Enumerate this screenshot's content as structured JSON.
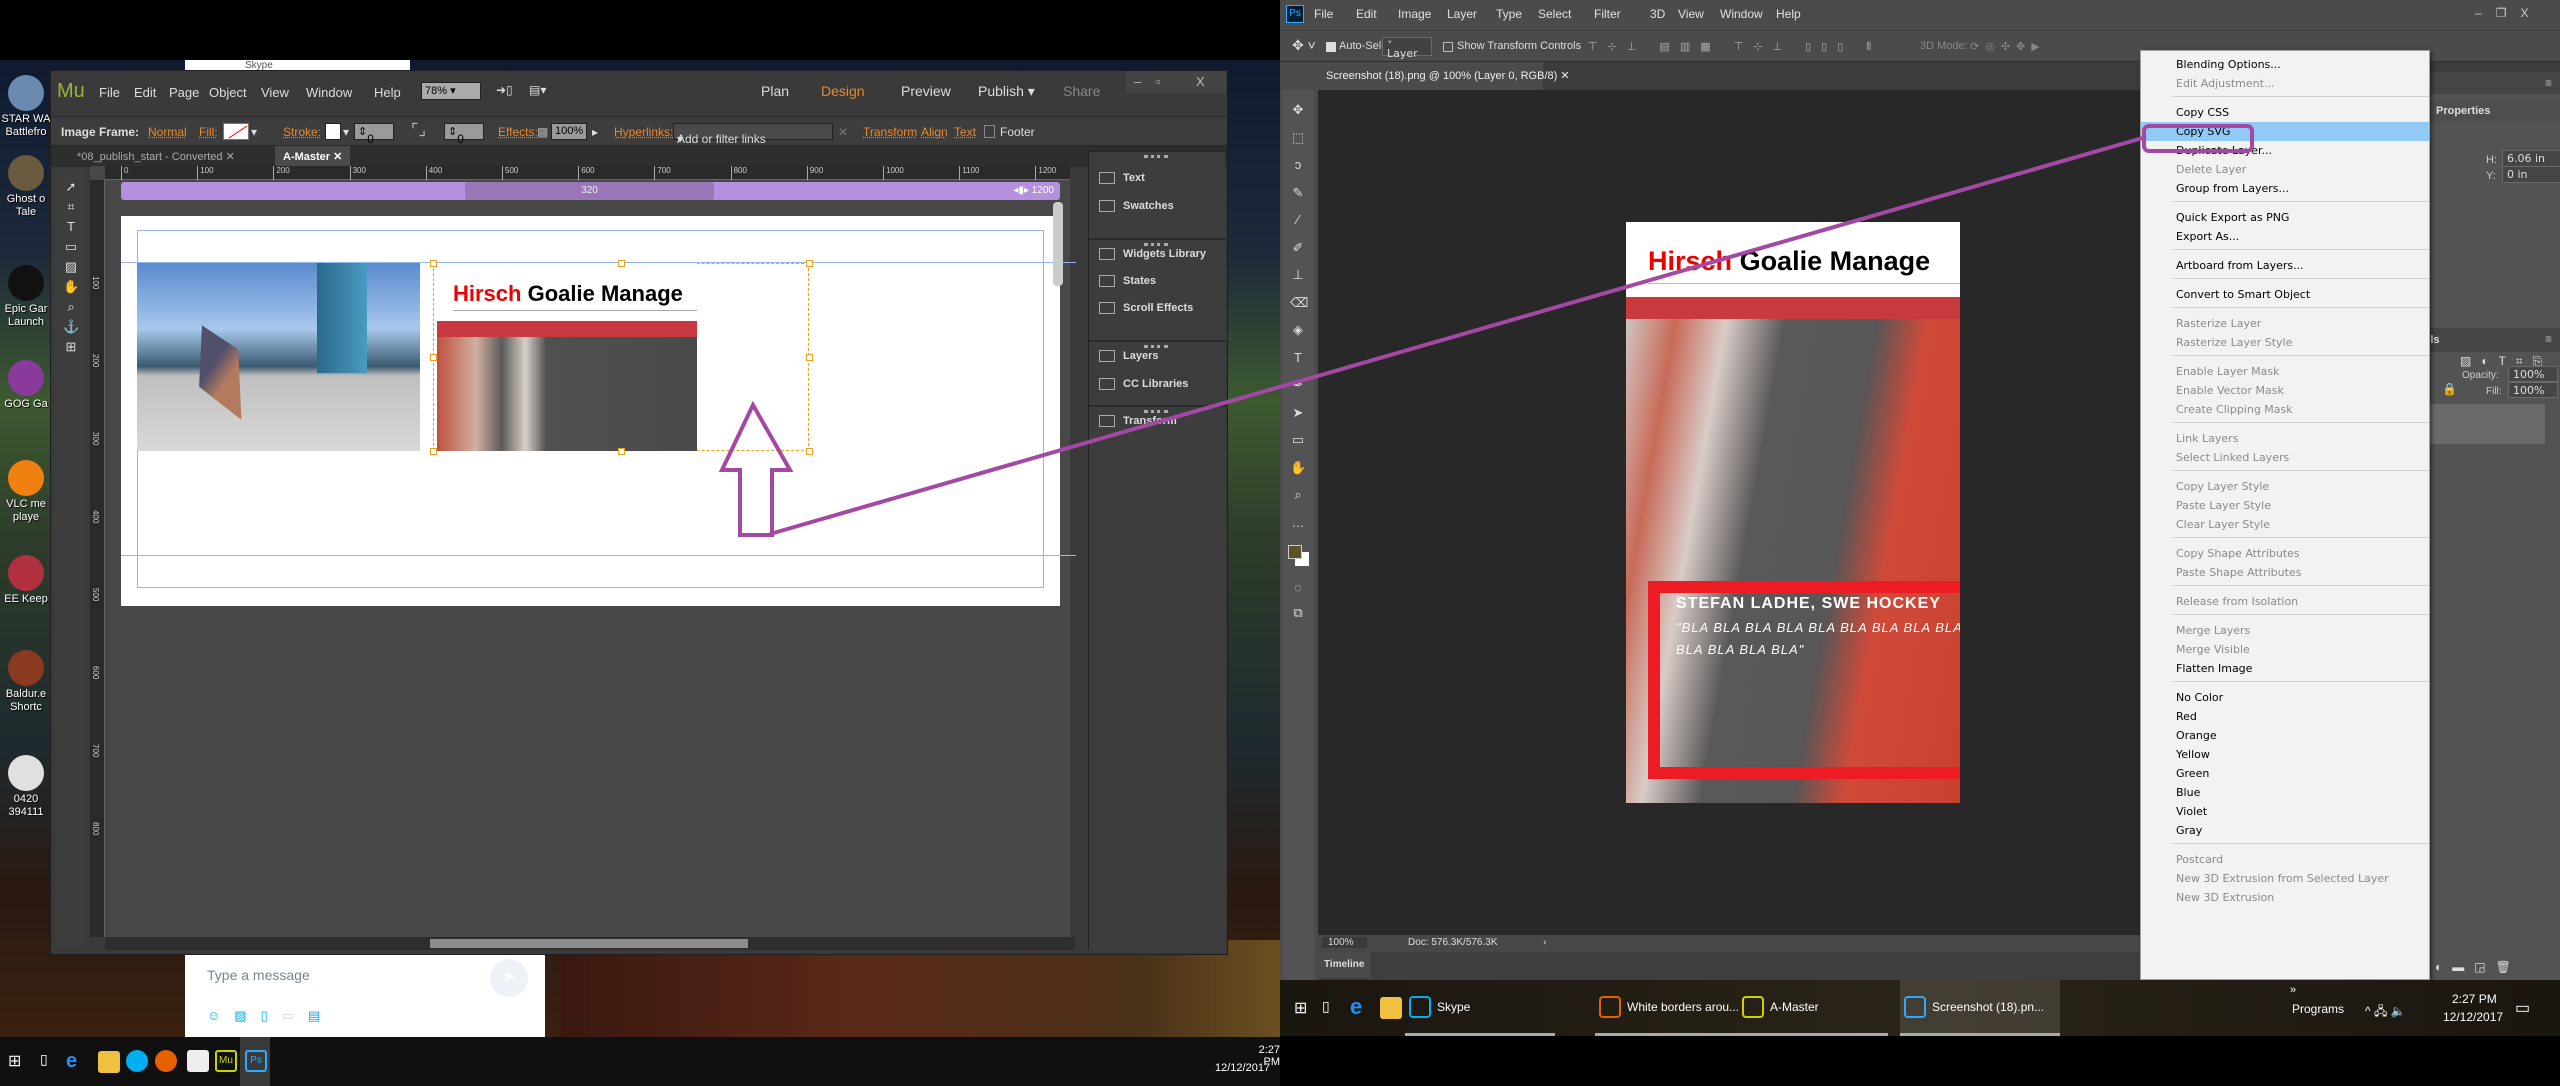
{
  "desktop": {
    "icons": [
      {
        "label": "STAR WA Battlefro",
        "color": "#6a8ab0"
      },
      {
        "label": "Ghost o Tale",
        "color": "#6a5a40"
      },
      {
        "label": "Epic Gar Launch",
        "color": "#111111"
      },
      {
        "label": "GOG Ga",
        "color": "#8a3a9a"
      },
      {
        "label": "VLC me playe",
        "color": "#f08010"
      },
      {
        "label": "EE Keep",
        "color": "#b03040"
      },
      {
        "label": "Baldur.e Shortc",
        "color": "#8a3a20"
      },
      {
        "label": "0420 394111",
        "color": "#e0e0e0"
      }
    ]
  },
  "skype": {
    "title": "Skype",
    "message_placeholder": "Type a message",
    "toolbar_icons": [
      "emoji-icon",
      "image-icon",
      "file-icon",
      "video-message-icon",
      "contact-icon"
    ]
  },
  "muse": {
    "logo": "Mu",
    "menu": [
      "File",
      "Edit",
      "Page",
      "Object",
      "View",
      "Window",
      "Help"
    ],
    "zoom": "78%",
    "modes": {
      "plan": "Plan",
      "design": "Design",
      "preview": "Preview",
      "publish": "Publish",
      "share": "Share"
    },
    "control_bar": {
      "image_frame_label": "Image Frame:",
      "image_frame_value": "Normal",
      "fill_label": "Fill:",
      "stroke_label": "Stroke:",
      "stroke_width": "0",
      "corner_radius": "0",
      "effects_label": "Effects:",
      "opacity": "100%",
      "hyperlinks_label": "Hyperlinks:",
      "hyperlinks_placeholder": "Add or filter links",
      "transform": "Transform",
      "align": "Align",
      "text": "Text",
      "footer": "Footer"
    },
    "tabs": [
      {
        "label": "*08_publish_start - Converted",
        "active": false
      },
      {
        "label": "A-Master",
        "active": true
      }
    ],
    "ruler_h": [
      "0",
      "100",
      "200",
      "300",
      "400",
      "500",
      "600",
      "700",
      "800",
      "900",
      "1000",
      "1100",
      "1200"
    ],
    "ruler_v": [
      "100",
      "200",
      "300",
      "400",
      "500",
      "600",
      "700",
      "800"
    ],
    "breakpoint_min": "320",
    "breakpoint_max": "1200",
    "page_heading_red": "Hirsch",
    "page_heading_black": "Goalie Manage",
    "panels": [
      "Text",
      "Swatches",
      "Widgets Library",
      "States",
      "Scroll Effects",
      "Layers",
      "CC Libraries",
      "Transform"
    ]
  },
  "photoshop": {
    "logo": "Ps",
    "menu": [
      "File",
      "Edit",
      "Image",
      "Layer",
      "Type",
      "Select",
      "Filter",
      "3D",
      "View",
      "Window",
      "Help"
    ],
    "options": {
      "auto_select_label": "Auto-Select:",
      "auto_select_checked": true,
      "auto_select_value": "Layer",
      "show_transform_label": "Show Transform Controls",
      "show_transform_checked": false,
      "mode_3d_label": "3D Mode:"
    },
    "doc_tab": "Screenshot (18).png @ 100% (Layer 0, RGB/8)",
    "document": {
      "heading_red": "Hirsch",
      "heading_black": "Goalie Manage",
      "caption": "STEFAN LADHE, SWE HOCKEY",
      "quote_line1": "\"BLA BLA BLA BLA BLA BLA BLA BLA BLA BL",
      "quote_line2": "BLA BLA BLA BLA\""
    },
    "status": {
      "zoom": "100%",
      "doc": "Doc: 576.3K/576.3K"
    },
    "timeline": "Timeline",
    "foreground_color": "#5f5226",
    "background_color": "#ffffff",
    "properties": {
      "title": "Properties",
      "h_label": "H:",
      "h_value": "6.06 in",
      "y_label": "Y:",
      "y_value": "0 in"
    },
    "layers": {
      "tab": "Channels",
      "opacity_label": "Opacity:",
      "opacity": "100%",
      "fill_label": "Fill:",
      "fill": "100%"
    },
    "context_menu": [
      [
        {
          "label": "Blending Options...",
          "enabled": true
        },
        {
          "label": "Edit Adjustment...",
          "enabled": false
        }
      ],
      [
        {
          "label": "Copy CSS",
          "enabled": true
        },
        {
          "label": "Copy SVG",
          "enabled": true,
          "highlighted": true
        },
        {
          "label": "Duplicate Layer...",
          "enabled": true
        },
        {
          "label": "Delete Layer",
          "enabled": false
        },
        {
          "label": "Group from Layers...",
          "enabled": true
        }
      ],
      [
        {
          "label": "Quick Export as PNG",
          "enabled": true
        },
        {
          "label": "Export As...",
          "enabled": true
        }
      ],
      [
        {
          "label": "Artboard from Layers...",
          "enabled": true
        }
      ],
      [
        {
          "label": "Convert to Smart Object",
          "enabled": true
        }
      ],
      [
        {
          "label": "Rasterize Layer",
          "enabled": false
        },
        {
          "label": "Rasterize Layer Style",
          "enabled": false
        }
      ],
      [
        {
          "label": "Enable Layer Mask",
          "enabled": false
        },
        {
          "label": "Enable Vector Mask",
          "enabled": false
        },
        {
          "label": "Create Clipping Mask",
          "enabled": false
        }
      ],
      [
        {
          "label": "Link Layers",
          "enabled": false
        },
        {
          "label": "Select Linked Layers",
          "enabled": false
        }
      ],
      [
        {
          "label": "Copy Layer Style",
          "enabled": false
        },
        {
          "label": "Paste Layer Style",
          "enabled": false
        },
        {
          "label": "Clear Layer Style",
          "enabled": false
        }
      ],
      [
        {
          "label": "Copy Shape Attributes",
          "enabled": false
        },
        {
          "label": "Paste Shape Attributes",
          "enabled": false
        }
      ],
      [
        {
          "label": "Release from Isolation",
          "enabled": false
        }
      ],
      [
        {
          "label": "Merge Layers",
          "enabled": false
        },
        {
          "label": "Merge Visible",
          "enabled": false
        },
        {
          "label": "Flatten Image",
          "enabled": true
        }
      ],
      [
        {
          "label": "No Color",
          "enabled": true
        },
        {
          "label": "Red",
          "enabled": true
        },
        {
          "label": "Orange",
          "enabled": true
        },
        {
          "label": "Yellow",
          "enabled": true
        },
        {
          "label": "Green",
          "enabled": true
        },
        {
          "label": "Blue",
          "enabled": true
        },
        {
          "label": "Violet",
          "enabled": true
        },
        {
          "label": "Gray",
          "enabled": true
        }
      ],
      [
        {
          "label": "Postcard",
          "enabled": false
        },
        {
          "label": "New 3D Extrusion from Selected Layer",
          "enabled": false
        },
        {
          "label": "New 3D Extrusion",
          "enabled": false
        }
      ]
    ]
  },
  "taskbar_left": {
    "time": "2:27 PM",
    "date": "12/12/2017"
  },
  "taskbar_right": {
    "apps": [
      {
        "label": "Skype",
        "icon": "skype-icon",
        "color": "#00aff0"
      },
      {
        "label": "White borders arou...",
        "icon": "firefox-icon",
        "color": "#e66000"
      },
      {
        "label": "A-Master",
        "icon": "muse-icon",
        "color": "#c8d400"
      },
      {
        "label": "Screenshot (18).pn...",
        "icon": "photoshop-icon",
        "color": "#31a8ff"
      }
    ],
    "programs": "Programs",
    "time": "2:27 PM",
    "date": "12/12/2017"
  },
  "annotation_color": "#a349a4"
}
